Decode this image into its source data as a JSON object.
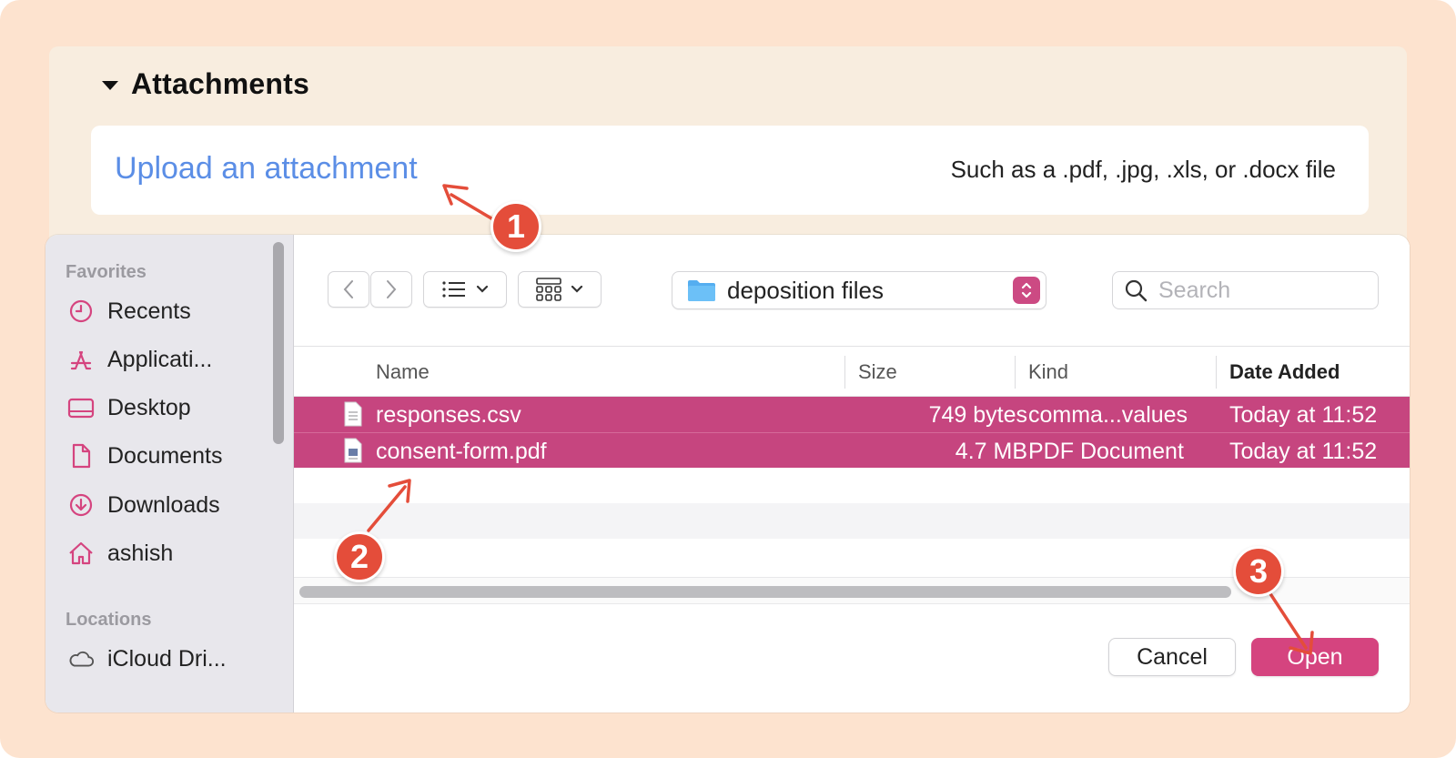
{
  "attachments": {
    "title": "Attachments",
    "upload_link": "Upload an attachment",
    "upload_hint": "Such as a .pdf, .jpg, .xls, or .docx file"
  },
  "sidebar": {
    "favorites_heading": "Favorites",
    "favorites": [
      {
        "label": "Recents",
        "icon": "clock-icon"
      },
      {
        "label": "Applicati...",
        "icon": "applications-icon"
      },
      {
        "label": "Desktop",
        "icon": "desktop-icon"
      },
      {
        "label": "Documents",
        "icon": "document-icon"
      },
      {
        "label": "Downloads",
        "icon": "download-icon"
      },
      {
        "label": "ashish",
        "icon": "home-icon"
      }
    ],
    "locations_heading": "Locations",
    "locations": [
      {
        "label": "iCloud Dri...",
        "icon": "cloud-icon"
      }
    ]
  },
  "toolbar": {
    "folder": "deposition files",
    "search_placeholder": "Search"
  },
  "columns": {
    "name": "Name",
    "size": "Size",
    "kind": "Kind",
    "date": "Date Added"
  },
  "files": [
    {
      "name": "responses.csv",
      "size": "749 bytes",
      "kind": "comma...values",
      "date": "Today at 11:52"
    },
    {
      "name": "consent-form.pdf",
      "size": "4.7 MB",
      "kind": "PDF Document",
      "date": "Today at 11:52"
    }
  ],
  "buttons": {
    "cancel": "Cancel",
    "open": "Open"
  },
  "annotations": [
    "1",
    "2",
    "3"
  ],
  "colors": {
    "accent": "#d5447f",
    "selection": "#c6457f",
    "link": "#5b8ee6",
    "badge": "#e44d3a",
    "background": "#fde3cf"
  }
}
